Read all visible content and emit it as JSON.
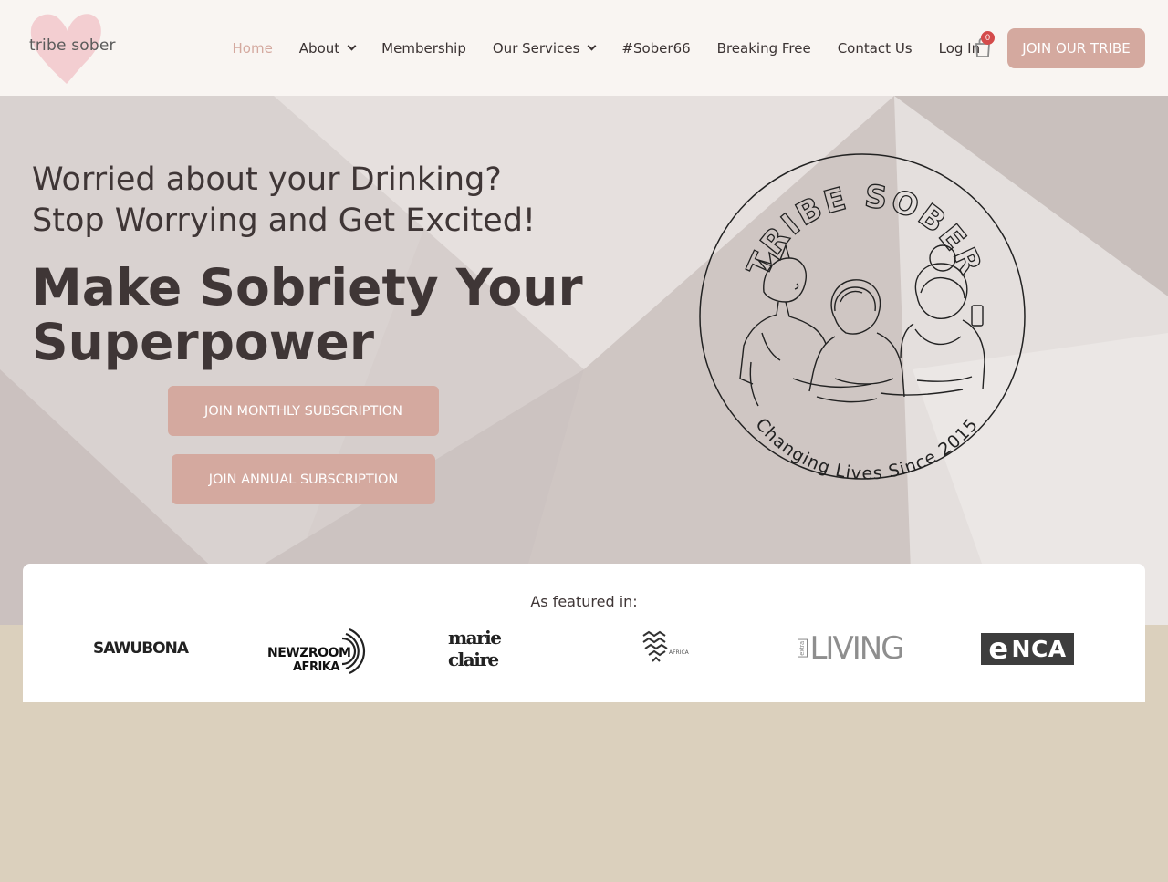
{
  "header": {
    "logo_text": "tribe sober",
    "nav": [
      {
        "label": "Home",
        "active": true
      },
      {
        "label": "About",
        "dropdown": true
      },
      {
        "label": "Membership"
      },
      {
        "label": "Our Services",
        "dropdown": true
      },
      {
        "label": "#Sober66"
      },
      {
        "label": "Breaking Free"
      },
      {
        "label": "Contact Us"
      },
      {
        "label": "Log In"
      }
    ],
    "cart_count": "0",
    "cta_label": "JOIN OUR TRIBE"
  },
  "hero": {
    "subtitle_line1": "Worried about your Drinking?",
    "subtitle_line2": "Stop Worrying and Get Excited!",
    "title": "Make Sobriety Your Superpower",
    "btn_monthly": "JOIN MONTHLY SUBSCRIPTION",
    "btn_annual": "JOIN ANNUAL SUBSCRIPTION",
    "seal_top": "TRIBE SOBER",
    "seal_bottom": "Changing Lives Since 2015"
  },
  "featured": {
    "title": "As featured in:",
    "logos": {
      "sawubona": "SAWUBONA",
      "newzroom_line1": "NEWZROOM",
      "newzroom_line2": "AFRIKA",
      "marie_claire": "marie claire",
      "africa": "AFRICA",
      "living_extra": "extra",
      "living": "LIVING",
      "enca_e": "e",
      "enca": "NCA"
    }
  },
  "colors": {
    "accent": "#d4a99f",
    "header_bg": "#f9f5f2",
    "hero_bg": "#d5cdcb",
    "page_bg": "#dbd0bd",
    "text_dark": "#3f3636"
  }
}
